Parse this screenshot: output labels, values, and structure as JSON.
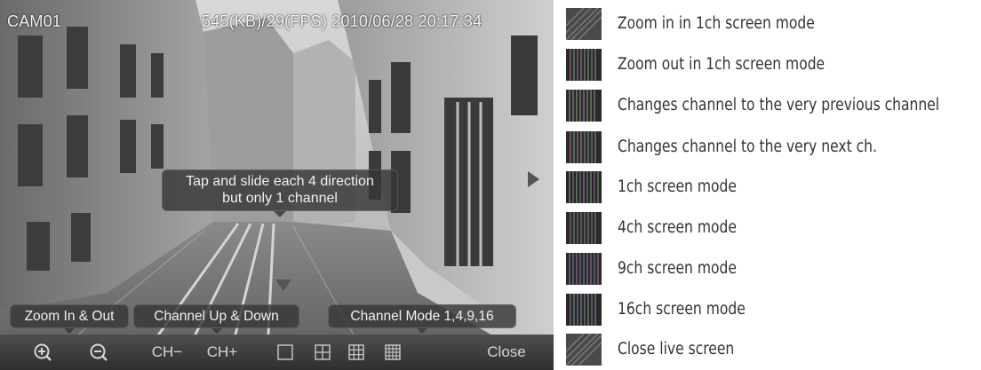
{
  "camera": {
    "name": "CAM01",
    "stats": "545(KB)/29(FPS) 2010/06/28 20:17:34"
  },
  "tooltips": {
    "swipe_line1": "Tap and slide each 4 direction",
    "swipe_line2": "but only 1 channel",
    "zoom": "Zoom In & Out",
    "channel": "Channel Up & Down",
    "mode": "Channel Mode 1,4,9,16"
  },
  "toolbar": {
    "zoom_in_icon": "magnifier-plus-icon",
    "zoom_out_icon": "magnifier-minus-icon",
    "ch_minus": "CH−",
    "ch_plus": "CH+",
    "split_1_icon": "single-screen-icon",
    "split_4_icon": "quad-screen-icon",
    "split_9_icon": "nine-screen-icon",
    "split_16_icon": "sixteen-screen-icon",
    "close": "Close"
  },
  "legend": [
    {
      "text": "Zoom in in 1ch screen mode"
    },
    {
      "text": "Zoom out in 1ch screen mode"
    },
    {
      "text": "Changes channel to the very previous channel"
    },
    {
      "text": "Changes channel to the very next ch."
    },
    {
      "text": "1ch screen mode"
    },
    {
      "text": "4ch screen mode"
    },
    {
      "text": "9ch screen mode"
    },
    {
      "text": "16ch screen mode"
    },
    {
      "text": "Close live screen"
    }
  ],
  "colors": {
    "toolbar_bg": "#3a3a3a",
    "tooltip_bg": "#373737",
    "legend_text": "#333333"
  }
}
